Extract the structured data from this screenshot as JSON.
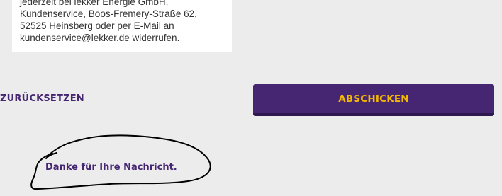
{
  "info_box": {
    "lines": [
      "jederzeit bei lekker Energie GmbH,",
      "Kundenservice, Boos-Fremery-Straße 62,",
      "52525 Heinsberg oder per E-Mail an",
      "kundenservice@lekker.de widerrufen."
    ]
  },
  "form": {
    "reset_label": "ZURÜCKSETZEN",
    "submit_label": "ABSCHICKEN"
  },
  "confirmation": {
    "message": "Danke für Ihre Nachricht."
  },
  "colors": {
    "brand_purple": "#462672",
    "accent_yellow": "#f5b800",
    "page_background": "#ececec",
    "box_background": "#ffffff"
  }
}
